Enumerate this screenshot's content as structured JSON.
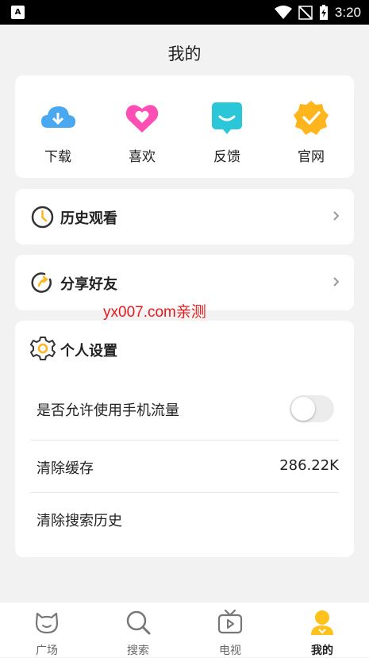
{
  "status_bar": {
    "time": "3:20",
    "left_icon_letter": "A"
  },
  "page_title": "我的",
  "quick_actions": [
    {
      "label": "下载",
      "icon": "download-cloud-icon",
      "color": "#4aa8f0"
    },
    {
      "label": "喜欢",
      "icon": "heart-icon",
      "color": "#ff4fb4"
    },
    {
      "label": "反馈",
      "icon": "feedback-icon",
      "color": "#2bc6d8"
    },
    {
      "label": "官网",
      "icon": "official-site-icon",
      "color": "#ffb51c"
    }
  ],
  "history": {
    "label": "历史观看",
    "icon": "clock-icon"
  },
  "share": {
    "label": "分享好友",
    "icon": "share-icon"
  },
  "watermark": "yx007.com亲测",
  "settings": {
    "title": "个人设置",
    "mobile_data": {
      "label": "是否允许使用手机流量",
      "enabled": false
    },
    "clear_cache": {
      "label": "清除缓存",
      "value": "286.22K"
    },
    "clear_search": {
      "label": "清除搜索历史"
    }
  },
  "tabs": [
    {
      "label": "广场",
      "icon": "square-cat-icon",
      "active": false
    },
    {
      "label": "搜索",
      "icon": "search-icon",
      "active": false
    },
    {
      "label": "电视",
      "icon": "tv-icon",
      "active": false
    },
    {
      "label": "我的",
      "icon": "profile-icon",
      "active": true,
      "color": "#ffc21a"
    }
  ]
}
